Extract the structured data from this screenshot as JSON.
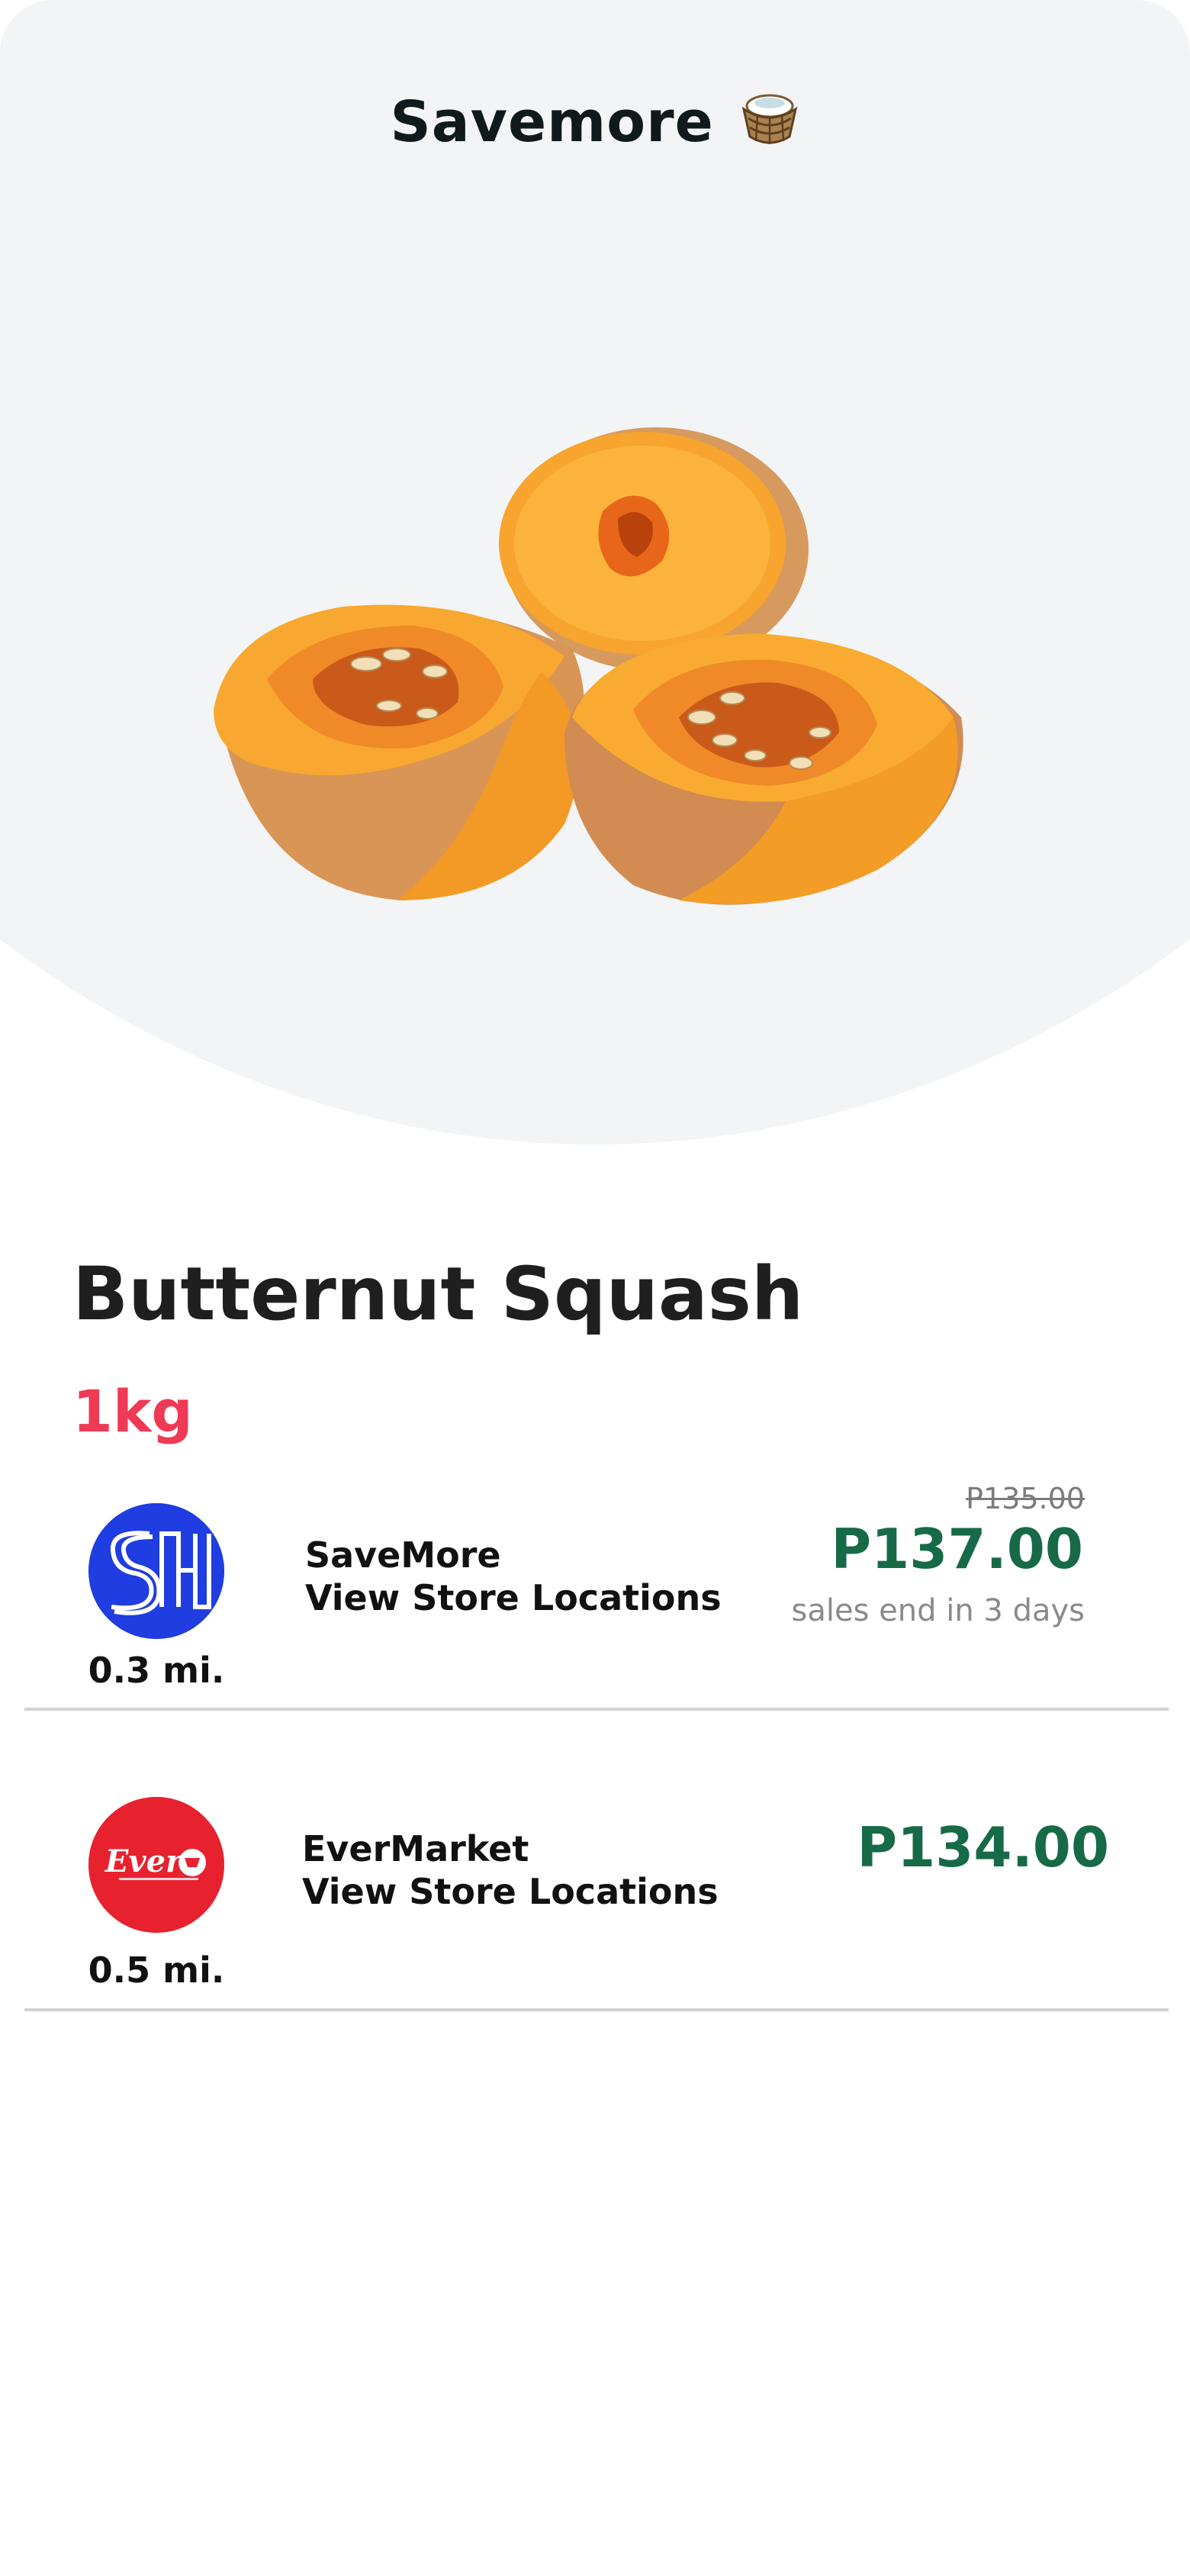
{
  "header": {
    "title": "Savemore",
    "title_icon": "basket-icon"
  },
  "product": {
    "image": "butternut-squash-image",
    "name": "Butternut Squash",
    "size": "1kg"
  },
  "stores": [
    {
      "name": "SaveMore",
      "link_label": "View Store Locations",
      "distance": "0.3 mi.",
      "logo": "sm-logo",
      "logo_color": "#1f3de0",
      "old_price": "P135.00",
      "price": "P137.00",
      "sale_note": "sales end in 3 days"
    },
    {
      "name": "EverMarket",
      "link_label": "View Store Locations",
      "distance": "0.5 mi.",
      "logo": "ever-logo",
      "logo_color": "#e8212f",
      "logo_text": "Ever",
      "price": "P134.00"
    }
  ],
  "colors": {
    "price": "#176a47",
    "size": "#ef3a55",
    "hero_bg": "#f3f4f5"
  }
}
